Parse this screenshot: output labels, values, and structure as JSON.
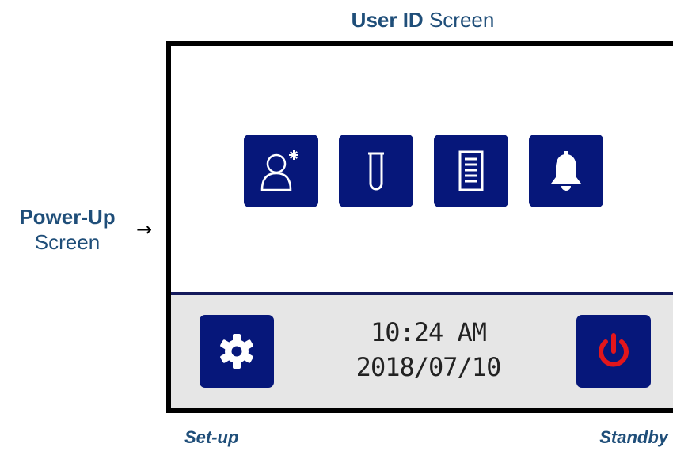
{
  "title": {
    "bold": "User ID",
    "rest": " Screen"
  },
  "side_label": {
    "bold": "Power-Up",
    "rest": "Screen",
    "arrow": "→"
  },
  "icons": [
    {
      "name": "user-id-icon"
    },
    {
      "name": "test-tube-icon"
    },
    {
      "name": "list-icon"
    },
    {
      "name": "bell-icon"
    }
  ],
  "footer": {
    "time": "10:24 AM",
    "date": "2018/07/10",
    "setup_icon": "gear-icon",
    "standby_icon": "power-icon"
  },
  "captions": {
    "setup": "Set-up",
    "standby": "Standby"
  },
  "colors": {
    "tile": "#06177a",
    "accent_text": "#1f4e79",
    "power": "#e3161b",
    "footer_bg": "#e6e6e6"
  }
}
